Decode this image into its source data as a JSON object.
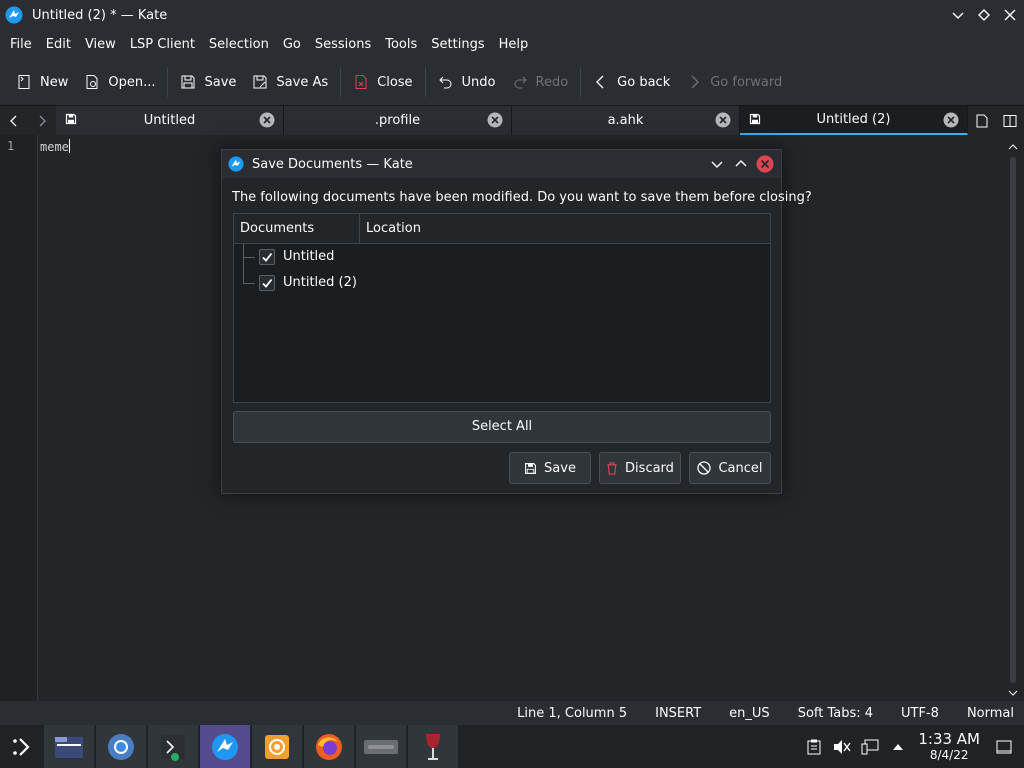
{
  "window": {
    "title": "Untitled (2) * — Kate",
    "icons": [
      "kate-icon",
      "minimize-icon",
      "maximize-icon",
      "close-icon"
    ]
  },
  "menubar": {
    "items": [
      "File",
      "Edit",
      "View",
      "LSP Client",
      "Selection",
      "Go",
      "Sessions",
      "Tools",
      "Settings",
      "Help"
    ]
  },
  "toolbar": {
    "new": "New",
    "open": "Open...",
    "save": "Save",
    "save_as": "Save As",
    "close": "Close",
    "undo": "Undo",
    "redo": "Redo",
    "go_back": "Go back",
    "go_forward": "Go forward"
  },
  "tabs": [
    {
      "label": "Untitled",
      "active": false
    },
    {
      "label": ".profile",
      "active": false
    },
    {
      "label": "a.ahk",
      "active": false
    },
    {
      "label": "Untitled (2)",
      "active": true
    }
  ],
  "editor": {
    "line_number": "1",
    "line_text": "meme"
  },
  "statusbar": {
    "position": "Line 1, Column 5",
    "mode": "INSERT",
    "dictionary": "en_US",
    "indent": "Soft Tabs: 4",
    "encoding": "UTF-8",
    "input_mode": "Normal"
  },
  "dialog": {
    "title": "Save Documents — Kate",
    "message": "The following documents have been modified. Do you want to save them before closing?",
    "columns": [
      "Documents",
      "Location"
    ],
    "documents": [
      {
        "name": "Untitled",
        "checked": true
      },
      {
        "name": "Untitled (2)",
        "checked": true
      }
    ],
    "select_all": "Select All",
    "save": "Save",
    "discard": "Discard",
    "cancel": "Cancel"
  },
  "taskbar": {
    "apps": [
      "application-launcher-icon",
      "dolphin-icon",
      "chromium-icon",
      "konsole-icon",
      "kate-icon",
      "photo-app-icon",
      "firefox-icon",
      "google-icon",
      "wine-icon"
    ],
    "time": "1:33 AM",
    "date": "8/4/22"
  },
  "colors": {
    "accent": "#3daee9",
    "close_red": "#da4453",
    "active_task": "#544c8c"
  }
}
